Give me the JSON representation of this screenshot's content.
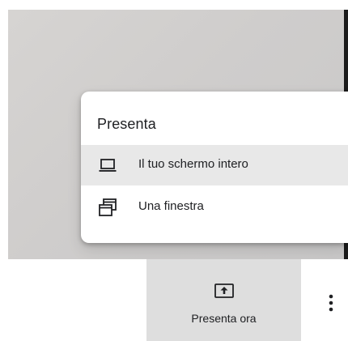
{
  "present_menu": {
    "title": "Presenta",
    "items": [
      {
        "label": "Il tuo schermo intero",
        "icon": "laptop-icon",
        "highlighted": true
      },
      {
        "label": "Una finestra",
        "icon": "window-icon",
        "highlighted": false
      }
    ]
  },
  "toolbar": {
    "present_now_label": "Presenta ora",
    "present_now_icon": "present-to-all-icon",
    "more_icon": "more-vert-icon"
  },
  "colors": {
    "highlight": "#e8e8e8",
    "button_background": "#dedede",
    "text": "#202124"
  }
}
